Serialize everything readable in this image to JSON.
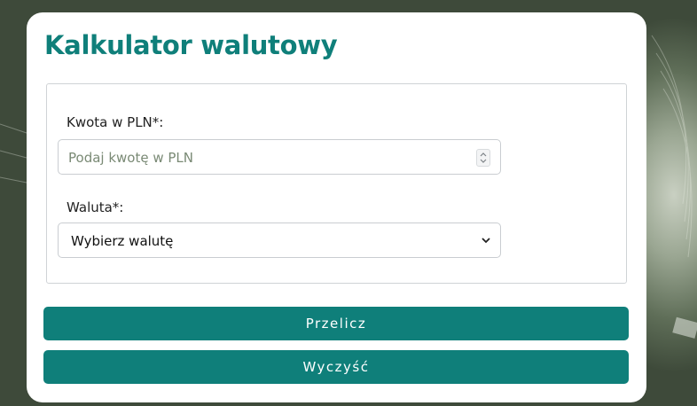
{
  "calculator": {
    "title": "Kalkulator walutowy",
    "amount_label": "Kwota w PLN*:",
    "amount_placeholder": "Podaj kwotę w PLN",
    "currency_label": "Waluta*:",
    "currency_selected": "Wybierz walutę",
    "convert_button": "Przelicz",
    "clear_button": "Wyczyść"
  },
  "colors": {
    "accent": "#0f7f7a",
    "card": "#ffffff",
    "border": "#cfd3d6"
  },
  "icons": {
    "spinner": "number-spinner-icon",
    "dropdown": "chevron-down-icon"
  }
}
